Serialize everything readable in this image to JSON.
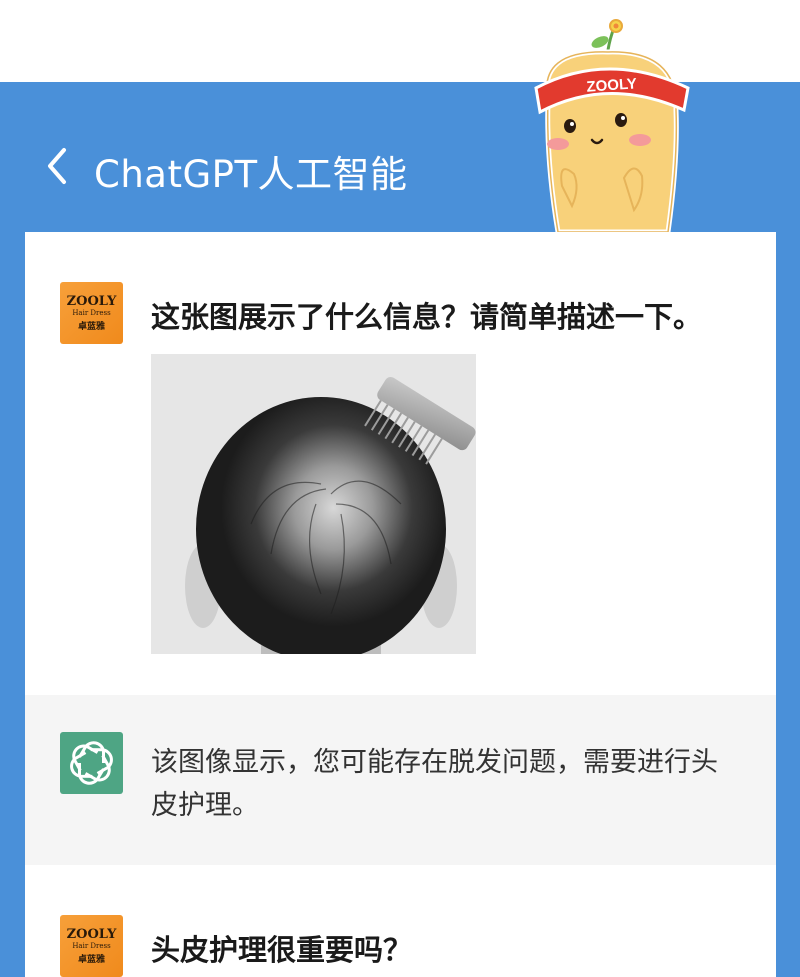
{
  "header": {
    "title": "ChatGPT人工智能",
    "mascot_label": "ZOOLY"
  },
  "brand": {
    "logo_text": "ZOOLY",
    "logo_subtitle": "Hair Dress",
    "logo_chinese": "卓蓝雅"
  },
  "conversation": [
    {
      "role": "user",
      "text": "这张图展示了什么信息？请简单描述一下。",
      "has_image": true
    },
    {
      "role": "assistant",
      "text": "该图像显示，您可能存在脱发问题，需要进行头皮护理。"
    },
    {
      "role": "user",
      "text": "头皮护理很重要吗？"
    }
  ],
  "colors": {
    "header_blue": "#4a90d9",
    "user_avatar": "#f49322",
    "assistant_avatar": "#4ea584",
    "answer_bg": "#f5f5f5"
  },
  "icons": {
    "back": "chevron-left-icon",
    "assistant": "openai-logo-icon"
  }
}
